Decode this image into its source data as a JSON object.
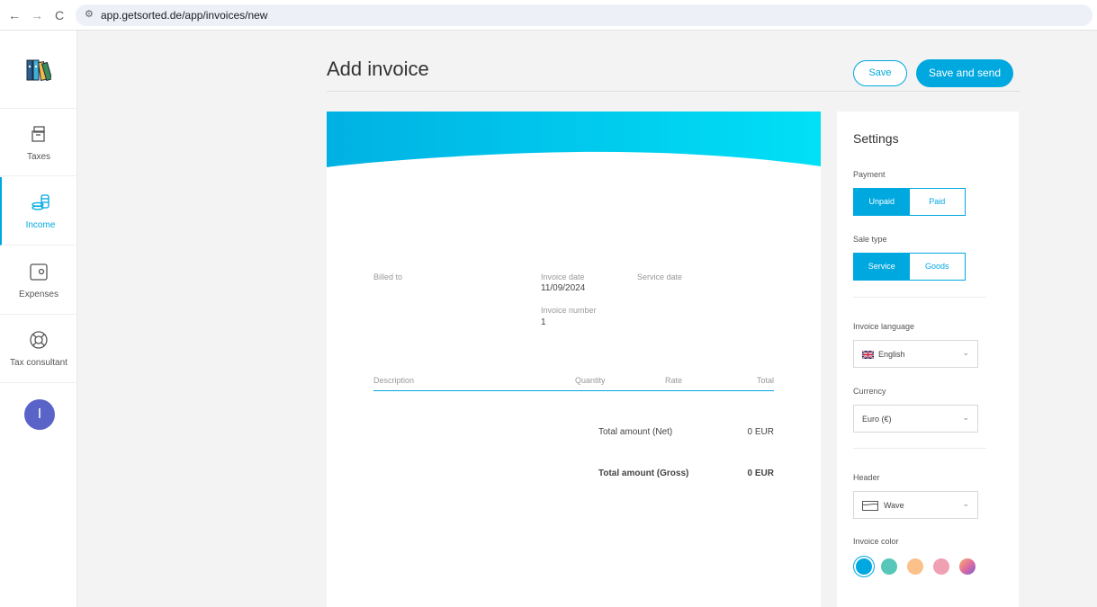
{
  "browser": {
    "back": "←",
    "forward": "→",
    "reload": "C",
    "url": "app.getsorted.de/app/invoices/new"
  },
  "sidebar": {
    "items": [
      {
        "label": "Taxes",
        "icon": "box-icon"
      },
      {
        "label": "Income",
        "icon": "coins-icon",
        "active": true
      },
      {
        "label": "Expenses",
        "icon": "wallet-icon"
      },
      {
        "label": "Tax consultant",
        "icon": "lifebuoy-icon"
      }
    ],
    "avatar": "I"
  },
  "header": {
    "title": "Add invoice",
    "save": "Save",
    "save_send": "Save and send"
  },
  "invoice": {
    "billed_to": "Billed to",
    "invoice_date_label": "Invoice date",
    "invoice_date": "11/09/2024",
    "service_date_label": "Service date",
    "invoice_number_label": "Invoice number",
    "invoice_number": "1",
    "columns": [
      "Description",
      "Quantity",
      "Rate",
      "Total"
    ],
    "net_label": "Total amount (Net)",
    "net_value": "0 EUR",
    "gross_label": "Total amount (Gross)",
    "gross_value": "0 EUR",
    "header_color": "#00b9e8"
  },
  "settings": {
    "title": "Settings",
    "payment_label": "Payment",
    "payment_options": [
      "Unpaid",
      "Paid"
    ],
    "sale_type_label": "Sale type",
    "sale_type_options": [
      "Service",
      "Goods"
    ],
    "language_label": "Invoice language",
    "language": "English",
    "currency_label": "Currency",
    "currency": "Euro (€)",
    "header_label": "Header",
    "header": "Wave",
    "color_label": "Invoice color",
    "colors": [
      "#00a8e0",
      "#56c7b8",
      "#fcc08a",
      "#f0a0b3",
      "gradient"
    ]
  },
  "theme": {
    "accent": "#00a8e0",
    "avatar": "#5a63c8"
  }
}
